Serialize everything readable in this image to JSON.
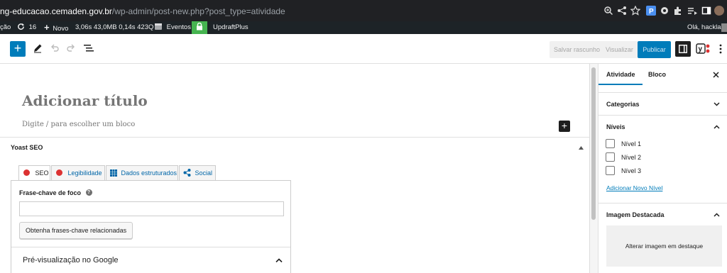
{
  "browser": {
    "url_host": "ng-educacao.cemaden.gov.br",
    "url_path": "/wp-admin/post-new.php?post_type=atividade"
  },
  "adminbar": {
    "cut_label": "ção",
    "updates_count": "16",
    "new_label": "Novo",
    "stats": "3,06s  43,0MB  0,14s  423Q",
    "events_label": "Eventos",
    "plugin_label": "UpdraftPlus",
    "greeting": "Olá, hacklab"
  },
  "header": {
    "save_draft_label": "Salvar rascunho",
    "preview_label": "Visualizar",
    "publish_label": "Publicar",
    "brand_color": "#007cba"
  },
  "editor": {
    "title_placeholder": "Adicionar título",
    "block_placeholder": "Digite / para escolher um bloco"
  },
  "yoast": {
    "panel_title": "Yoast SEO",
    "tabs": [
      "SEO",
      "Legibilidade",
      "Dados estruturados",
      "Social"
    ],
    "focus_label": "Frase-chave de foco",
    "related_button": "Obtenha frases-chave relacionadas",
    "google_preview": "Pré-visualização no Google"
  },
  "sidebar": {
    "tab_activity": "Atividade",
    "tab_block": "Bloco",
    "categories_label": "Categorias",
    "levels_label": "Níveis",
    "levels": [
      "Nível 1",
      "Nível 2",
      "Nível 3"
    ],
    "add_level_link": "Adicionar Novo Nível",
    "featured_label": "Imagem Destacada",
    "featured_button": "Alterar imagem em destaque"
  }
}
